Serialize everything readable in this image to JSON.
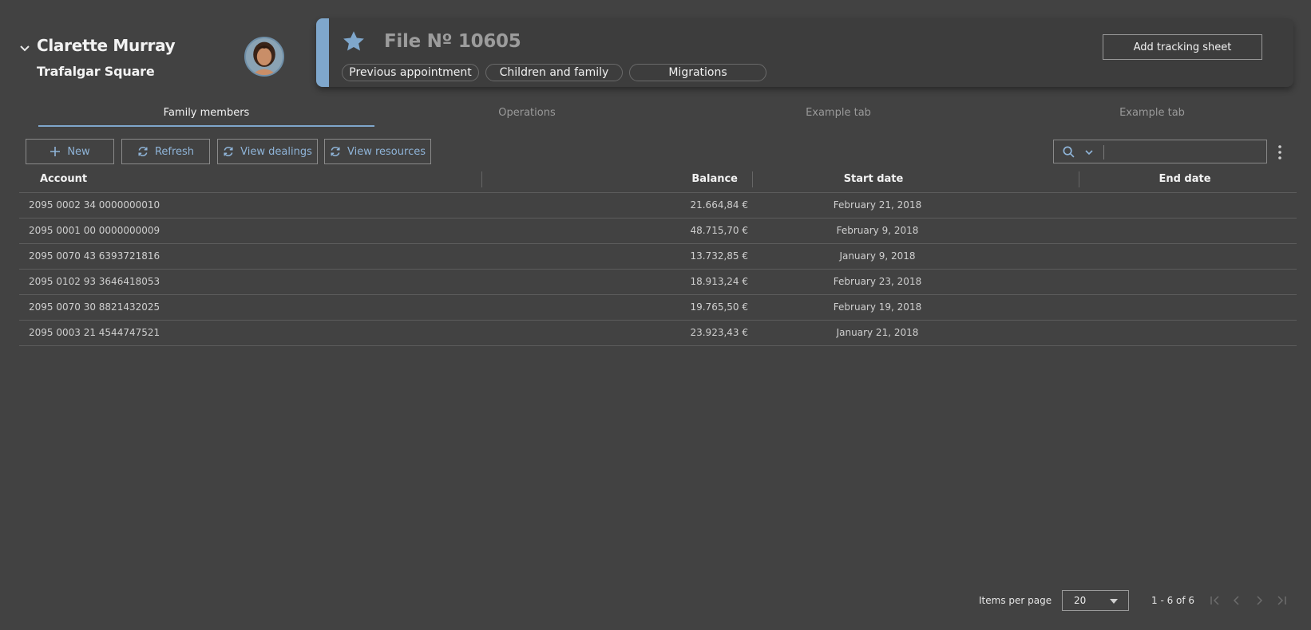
{
  "person": {
    "name": "Clarette Murray",
    "location": "Trafalgar Square"
  },
  "file": {
    "title": "File Nº 10605",
    "chips": [
      "Previous appointment",
      "Children and family",
      "Migrations"
    ],
    "add_button": "Add tracking sheet"
  },
  "tabs": [
    {
      "label": "Family members",
      "active": true
    },
    {
      "label": "Operations",
      "active": false
    },
    {
      "label": "Example tab",
      "active": false
    },
    {
      "label": "Example tab",
      "active": false
    }
  ],
  "toolbar": {
    "new": "New",
    "refresh": "Refresh",
    "view_dealings": "View dealings",
    "view_resources": "View resources"
  },
  "search": {
    "value": "",
    "placeholder": ""
  },
  "table": {
    "headers": [
      "Account",
      "Balance",
      "Start date",
      "End date"
    ],
    "rows": [
      {
        "account": "2095 0002 34 0000000010",
        "balance": "21.664,84 €",
        "start": "February 21, 2018",
        "end": ""
      },
      {
        "account": "2095 0001 00 0000000009",
        "balance": "48.715,70 €",
        "start": "February 9, 2018",
        "end": ""
      },
      {
        "account": "2095 0070 43 6393721816",
        "balance": "13.732,85 €",
        "start": "January 9, 2018",
        "end": ""
      },
      {
        "account": "2095 0102 93 3646418053",
        "balance": "18.913,24 €",
        "start": "February 23, 2018",
        "end": ""
      },
      {
        "account": "2095 0070 30 8821432025",
        "balance": "19.765,50 €",
        "start": "February 19, 2018",
        "end": ""
      },
      {
        "account": "2095 0003 21 4544747521",
        "balance": "23.923,43 €",
        "start": "January 21, 2018",
        "end": ""
      }
    ]
  },
  "paginator": {
    "items_per_page_label": "Items per page",
    "items_per_page": "20",
    "range": "1 - 6 of 6"
  },
  "colors": {
    "background": "#424242",
    "accent": "#7fa7cc",
    "button_text": "#8fb4d8"
  }
}
